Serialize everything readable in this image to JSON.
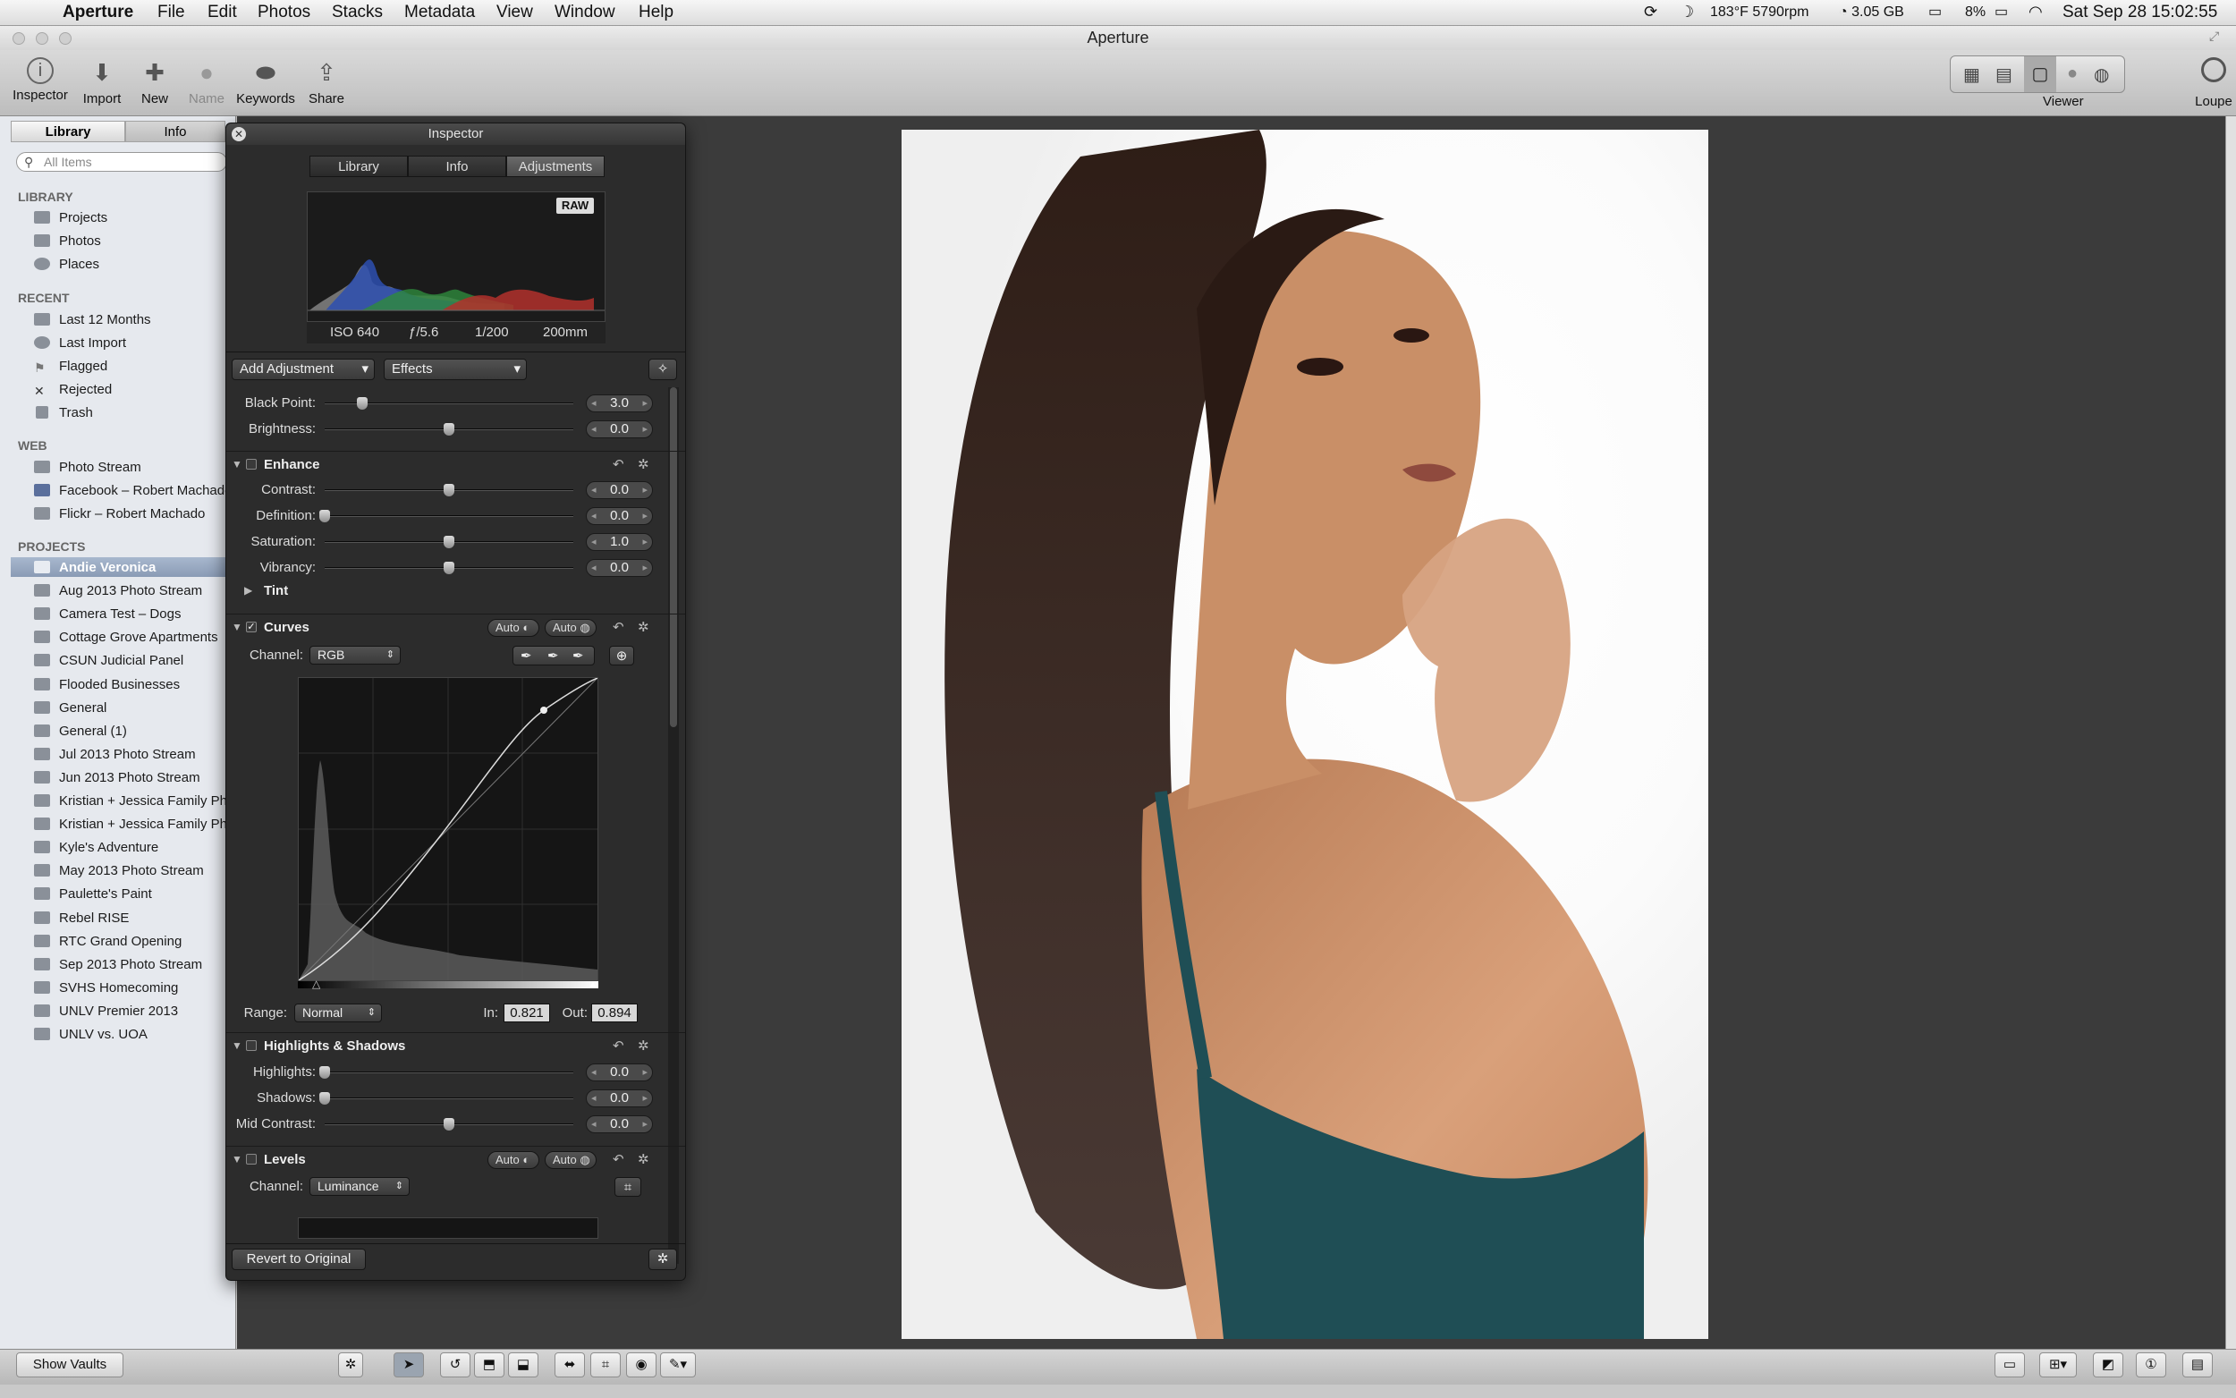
{
  "menubar": {
    "app_name": "Aperture",
    "menus": [
      "File",
      "Edit",
      "Photos",
      "Stacks",
      "Metadata",
      "View",
      "Window",
      "Help"
    ],
    "status_temp": "183°F 5790rpm",
    "status_disk": "3.05 GB",
    "status_battery": "8%",
    "datetime": "Sat Sep 28  15:02:55"
  },
  "window": {
    "title": "Aperture"
  },
  "toolbar": {
    "inspector": "Inspector",
    "import": "Import",
    "new": "New",
    "name": "Name",
    "keywords": "Keywords",
    "share": "Share",
    "viewer": "Viewer",
    "loupe": "Loupe"
  },
  "library": {
    "tabs": [
      "Library",
      "Info"
    ],
    "search_placeholder": "All Items",
    "sections": {
      "library": {
        "title": "LIBRARY",
        "items": [
          "Projects",
          "Photos",
          "Places"
        ]
      },
      "recent": {
        "title": "RECENT",
        "items": [
          "Last 12 Months",
          "Last Import",
          "Flagged",
          "Rejected",
          "Trash"
        ]
      },
      "web": {
        "title": "WEB",
        "items": [
          "Photo Stream",
          "Facebook – Robert Machado",
          "Flickr – Robert Machado"
        ]
      },
      "projects": {
        "title": "PROJECTS",
        "items": [
          "Andie Veronica",
          "Aug 2013 Photo Stream",
          "Camera Test – Dogs",
          "Cottage Grove Apartments",
          "CSUN Judicial Panel",
          "Flooded Businesses",
          "General",
          "General (1)",
          "Jul 2013 Photo Stream",
          "Jun 2013 Photo Stream",
          "Kristian + Jessica Family Photos",
          "Kristian + Jessica Family Photos",
          "Kyle's Adventure",
          "May 2013 Photo Stream",
          "Paulette's Paint",
          "Rebel RISE",
          "RTC Grand Opening",
          "Sep 2013 Photo Stream",
          "SVHS Homecoming",
          "UNLV Premier 2013",
          "UNLV vs. UOA"
        ]
      }
    },
    "selected_project": "Andie Veronica",
    "show_vaults": "Show Vaults"
  },
  "inspector": {
    "title": "Inspector",
    "tabs": [
      "Library",
      "Info",
      "Adjustments"
    ],
    "active_tab": "Adjustments",
    "histogram": {
      "badge": "RAW",
      "iso": "ISO 640",
      "aperture": "ƒ/5.6",
      "shutter": "1/200",
      "focal": "200mm"
    },
    "add_adjustment": "Add Adjustment",
    "effects": "Effects",
    "exposure": [
      {
        "label": "Black Point:",
        "value": "3.0",
        "level": 0.15
      },
      {
        "label": "Brightness:",
        "value": "0.0",
        "level": 0.5
      }
    ],
    "enhance": {
      "title": "Enhance",
      "sliders": [
        {
          "label": "Contrast:",
          "value": "0.0",
          "level": 0.5
        },
        {
          "label": "Definition:",
          "value": "0.0",
          "level": 0.0
        },
        {
          "label": "Saturation:",
          "value": "1.0",
          "level": 0.5
        },
        {
          "label": "Vibrancy:",
          "value": "0.0",
          "level": 0.5
        }
      ],
      "tint": "Tint"
    },
    "curves": {
      "title": "Curves",
      "auto1": "Auto",
      "auto2": "Auto",
      "channel_label": "Channel:",
      "channel": "RGB",
      "range_label": "Range:",
      "range": "Normal",
      "in_label": "In:",
      "in_value": "0.821",
      "out_label": "Out:",
      "out_value": "0.894"
    },
    "highlights_shadows": {
      "title": "Highlights & Shadows",
      "sliders": [
        {
          "label": "Highlights:",
          "value": "0.0",
          "level": 0.0
        },
        {
          "label": "Shadows:",
          "value": "0.0",
          "level": 0.0
        },
        {
          "label": "Mid Contrast:",
          "value": "0.0",
          "level": 0.5
        }
      ]
    },
    "levels": {
      "title": "Levels",
      "auto1": "Auto",
      "auto2": "Auto",
      "channel_label": "Channel:",
      "channel": "Luminance"
    },
    "revert": "Revert to Original"
  },
  "colors": {
    "accent_selection": "#8a9bb5",
    "hud_bg": "#2c2c2c",
    "viewer_bg": "#3b3b3b"
  }
}
